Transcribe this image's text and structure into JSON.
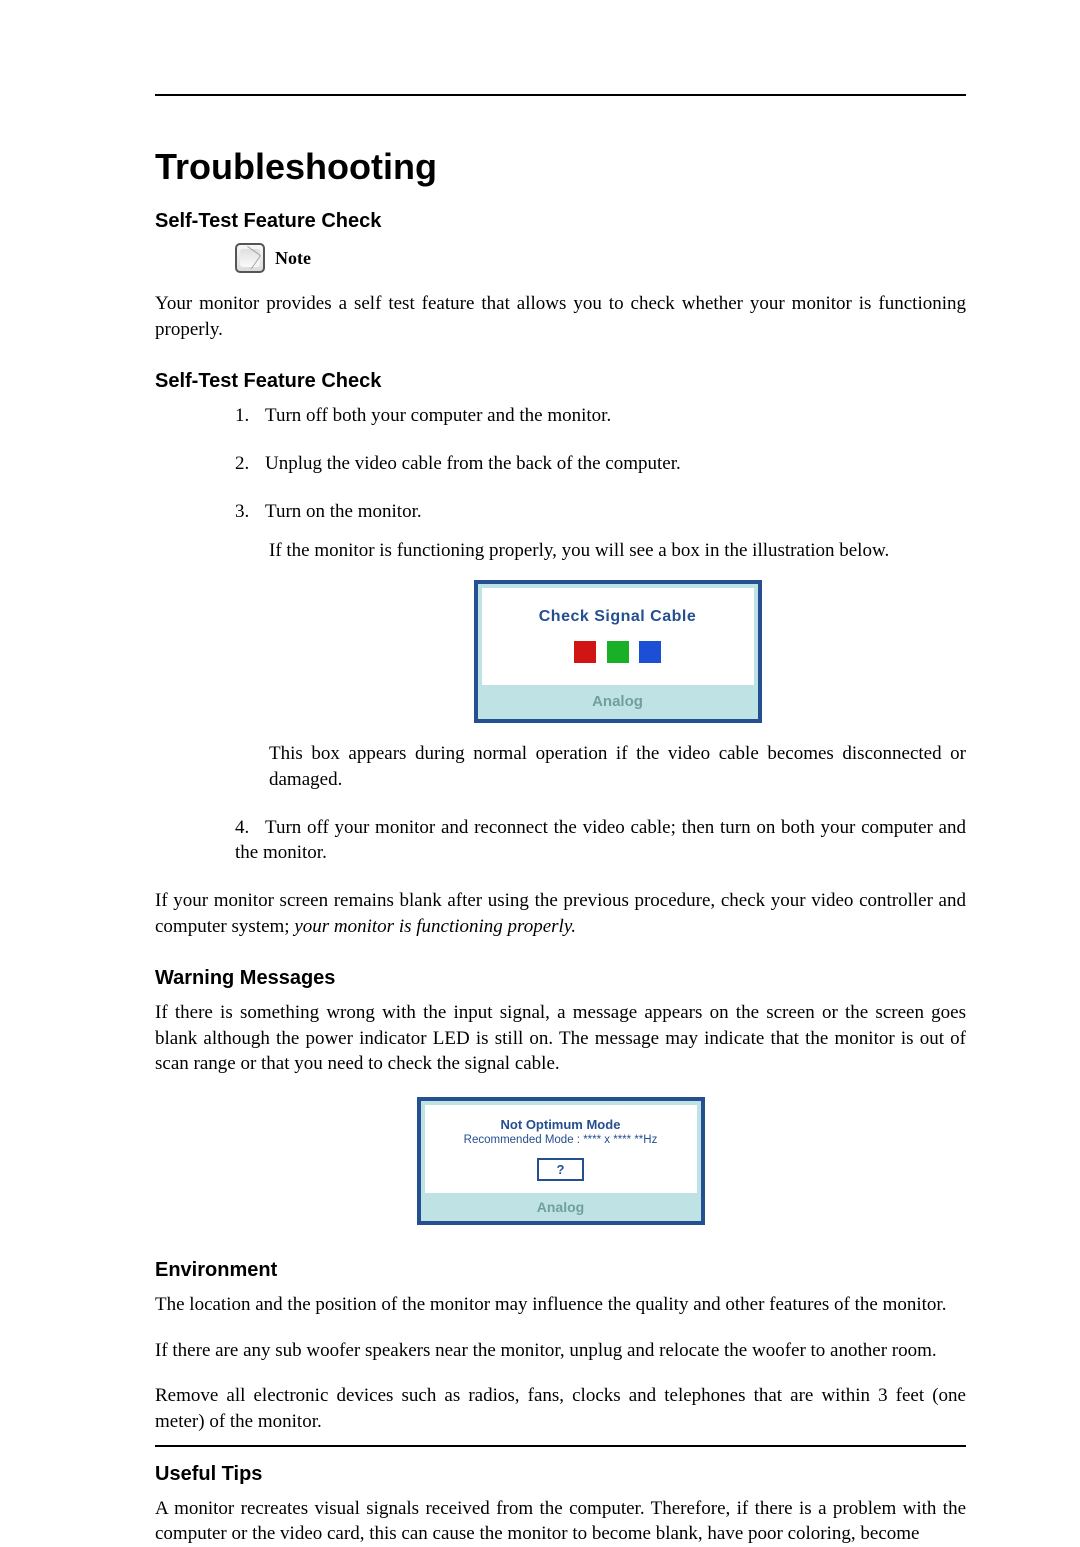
{
  "title": "Troubleshooting",
  "sections": {
    "selftest1": {
      "heading": "Self-Test Feature Check",
      "note_label": "Note",
      "note_body": "Your monitor provides a self test feature that allows you to check whether your monitor is functioning properly."
    },
    "selftest2": {
      "heading": "Self-Test Feature Check",
      "steps": [
        "Turn off both your computer and the monitor.",
        "Unplug the video cable from the back of the computer.",
        "Turn on the monitor."
      ],
      "step3_cont1": "If the monitor is functioning properly, you will see a box in the illustration below.",
      "step3_cont2": "This box appears during normal operation if the video cable becomes disconnected or damaged.",
      "step4": "Turn off your monitor and reconnect the video cable; then turn on both your computer and the monitor.",
      "after_text": "If your monitor screen remains blank after using the previous procedure, check your video controller and computer system; ",
      "after_italic": "your monitor is functioning properly."
    },
    "osd1": {
      "title": "Check Signal Cable",
      "squares": [
        "#d11414",
        "#19b028",
        "#1d4fd6"
      ],
      "bar": "Analog"
    },
    "warning": {
      "heading": "Warning Messages",
      "body": "If there is something wrong with the input signal, a message appears on the screen or the screen goes blank although the power indicator LED is still on. The message may indicate that the monitor is out of scan range or that you need to check the signal cable."
    },
    "osd2": {
      "line1": "Not Optimum Mode",
      "line2": "Recommended Mode : **** x ****  **Hz",
      "qmark": "?",
      "bar": "Analog"
    },
    "environment": {
      "heading": "Environment",
      "p1": "The location and the position of the monitor may influence the quality and other features of the monitor.",
      "p2": "If there are any sub woofer speakers near the monitor, unplug and relocate the woofer to another room.",
      "p3": "Remove all electronic devices such as radios, fans, clocks and telephones that are within 3 feet (one meter) of the monitor."
    },
    "tips": {
      "heading": "Useful Tips",
      "body": "A monitor recreates visual signals received from the computer. Therefore, if there is a problem with the computer or the video card, this can cause the monitor to become blank, have poor coloring, become"
    }
  }
}
